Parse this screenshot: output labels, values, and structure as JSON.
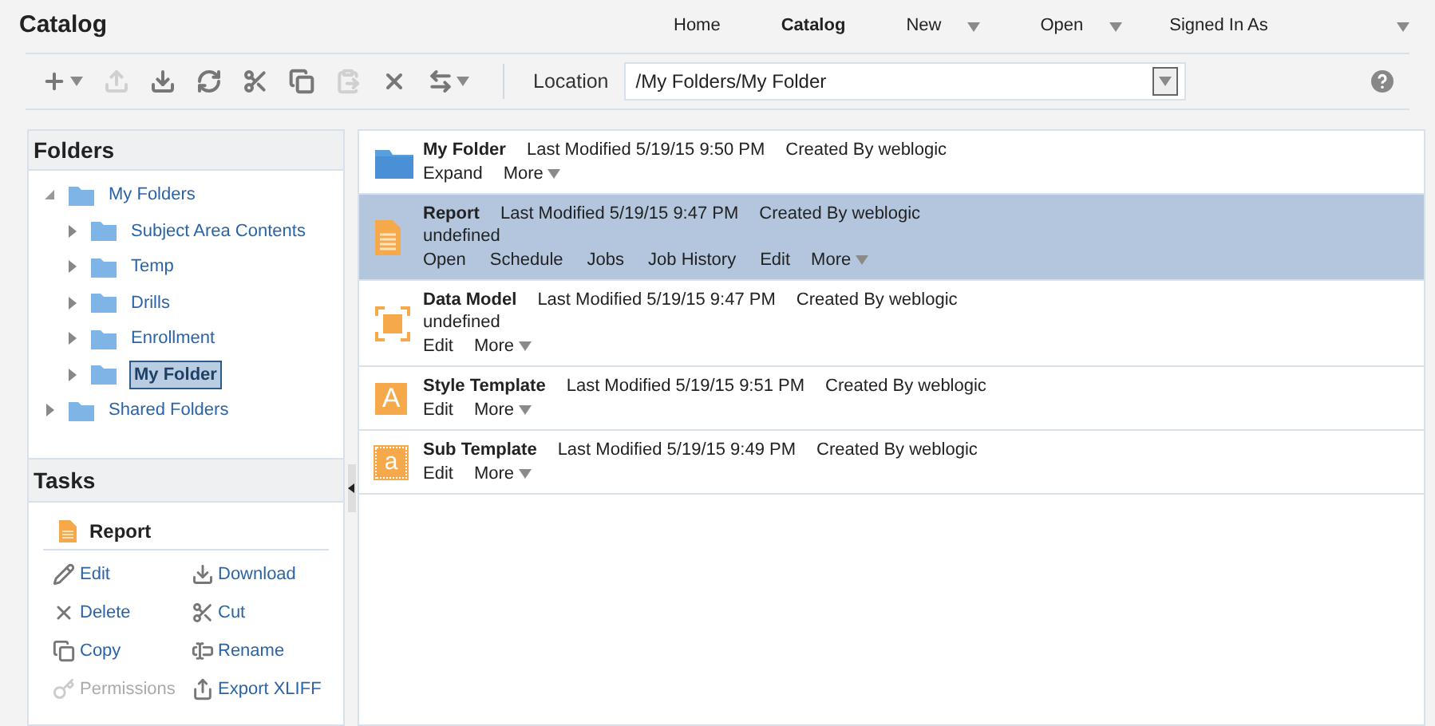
{
  "header": {
    "title": "Catalog",
    "nav": [
      {
        "label": "Home",
        "selected": false,
        "dropdown": false
      },
      {
        "label": "Catalog",
        "selected": true,
        "dropdown": false
      },
      {
        "label": "New",
        "selected": false,
        "dropdown": true
      },
      {
        "label": "Open",
        "selected": false,
        "dropdown": true
      },
      {
        "label": "Signed In As",
        "selected": false,
        "dropdown": true
      }
    ]
  },
  "toolbar": {
    "buttons": [
      {
        "kind": "add",
        "disabled": false,
        "dropdown": true
      },
      {
        "kind": "upload",
        "disabled": true,
        "dropdown": false
      },
      {
        "kind": "download",
        "disabled": false,
        "dropdown": false
      },
      {
        "kind": "refresh",
        "disabled": false,
        "dropdown": false
      },
      {
        "kind": "cut",
        "disabled": false,
        "dropdown": false
      },
      {
        "kind": "copy",
        "disabled": false,
        "dropdown": false
      },
      {
        "kind": "paste",
        "disabled": true,
        "dropdown": false
      },
      {
        "kind": "delete",
        "disabled": false,
        "dropdown": false
      },
      {
        "kind": "move",
        "disabled": false,
        "dropdown": true
      }
    ],
    "location_label": "Location",
    "location": "/My Folders/My Folder"
  },
  "folders": {
    "title": "Folders",
    "tree": [
      {
        "label": "My Folders",
        "expanded": true,
        "selected": false,
        "children": [
          {
            "label": "Subject Area Contents",
            "expanded": false,
            "selected": false
          },
          {
            "label": "Temp",
            "expanded": false,
            "selected": false
          },
          {
            "label": "Drills",
            "expanded": false,
            "selected": false
          },
          {
            "label": "Enrollment",
            "expanded": false,
            "selected": false
          },
          {
            "label": "My Folder",
            "expanded": false,
            "selected": true
          }
        ]
      },
      {
        "label": "Shared Folders",
        "expanded": false,
        "selected": false
      }
    ]
  },
  "tasks": {
    "title": "Tasks",
    "item": "Report",
    "actions": [
      {
        "kind": "edit",
        "label": "Edit",
        "disabled": false
      },
      {
        "kind": "download",
        "label": "Download",
        "disabled": false
      },
      {
        "kind": "delete",
        "label": "Delete",
        "disabled": false
      },
      {
        "kind": "cut",
        "label": "Cut",
        "disabled": false
      },
      {
        "kind": "copy",
        "label": "Copy",
        "disabled": false
      },
      {
        "kind": "rename",
        "label": "Rename",
        "disabled": false
      },
      {
        "kind": "permissions",
        "label": "Permissions",
        "disabled": true
      },
      {
        "kind": "export",
        "label": "Export XLIFF",
        "disabled": false
      }
    ]
  },
  "items": [
    {
      "kind": "folder",
      "name": "My Folder",
      "modified": "Last Modified 5/19/15 9:50 PM",
      "created": "Created By weblogic",
      "selected": false,
      "actions": [
        "Expand"
      ],
      "more": "More"
    },
    {
      "kind": "report",
      "name": "Report",
      "modified": "Last Modified 5/19/15 9:47 PM",
      "created": "Created By weblogic",
      "description": "undefined",
      "selected": true,
      "actions": [
        "Open",
        "Schedule",
        "Jobs",
        "Job History",
        "Edit"
      ],
      "more": "More"
    },
    {
      "kind": "datamodel",
      "name": "Data Model",
      "modified": "Last Modified 5/19/15 9:47 PM",
      "created": "Created By weblogic",
      "description": "undefined",
      "selected": false,
      "actions": [
        "Edit"
      ],
      "more": "More"
    },
    {
      "kind": "style",
      "icon_text": "A",
      "name": "Style Template",
      "modified": "Last Modified 5/19/15 9:51 PM",
      "created": "Created By weblogic",
      "selected": false,
      "actions": [
        "Edit"
      ],
      "more": "More"
    },
    {
      "kind": "sub",
      "icon_text": "a",
      "name": "Sub Template",
      "modified": "Last Modified 5/19/15 9:49 PM",
      "created": "Created By weblogic",
      "selected": false,
      "actions": [
        "Edit"
      ],
      "more": "More"
    }
  ]
}
